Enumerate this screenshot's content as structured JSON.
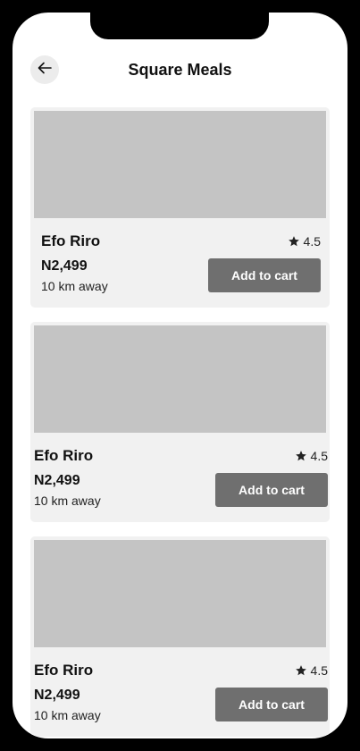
{
  "header": {
    "title": "Square Meals"
  },
  "meals": [
    {
      "name": "Efo Riro",
      "price": "N2,499",
      "distance": "10 km away",
      "rating": "4.5",
      "cart_label": "Add to cart"
    },
    {
      "name": "Efo Riro",
      "price": "N2,499",
      "distance": "10 km away",
      "rating": "4.5",
      "cart_label": "Add to cart"
    },
    {
      "name": "Efo Riro",
      "price": "N2,499",
      "distance": "10 km away",
      "rating": "4.5",
      "cart_label": "Add to cart"
    }
  ],
  "icons": {
    "back": "arrow-left-icon",
    "rating": "star-icon"
  },
  "colors": {
    "button": "#6f6f6f",
    "card_background": "#f1f1f1",
    "image_placeholder": "#c4c4c4"
  }
}
